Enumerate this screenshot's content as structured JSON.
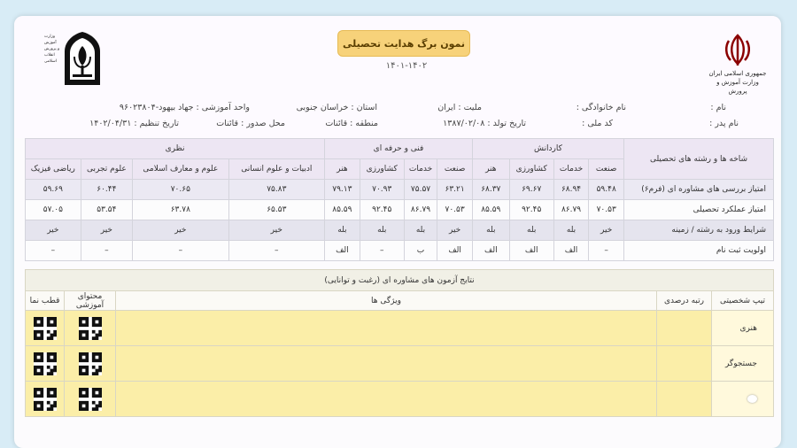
{
  "header": {
    "title": "نمون برگ هدایت تحصیلی",
    "year": "۱۴۰۱-۱۴۰۲",
    "right_logo_lines": [
      "جمهوری اسلامی ایران",
      "وزارت آموزش و پرورش"
    ],
    "left_logo_lines": [
      "وزارت آموزش",
      "و پرورش",
      "انقلاب",
      "اسلامی"
    ]
  },
  "info": {
    "name": "نام :",
    "family": "نام خانوادگی :",
    "nationality": "ملیت : ایران",
    "province": "استان : خراسان جنوبی",
    "unit": "واحد آموزشی : جهاد بیهود-۹۶۰۲۳۸۰۴",
    "father": "نام پدر :",
    "national_code": "کد ملی :",
    "birth": "تاریخ تولد : ۱۳۸۷/۰۲/۰۸",
    "region": "منطقه : قائنات",
    "issue_place": "محل صدور : قائنات",
    "set_date": "تاریخ تنظیم : ۱۴۰۲/۰۴/۳۱"
  },
  "table1": {
    "corner": "شاخه ها و رشته های تحصیلی",
    "groups": [
      "کاردانش",
      "فنی و حرفه ای",
      "نظری"
    ],
    "columns": [
      "صنعت",
      "خدمات",
      "کشاورزی",
      "هنر",
      "صنعت",
      "خدمات",
      "کشاورزی",
      "هنر",
      "ادبیات و علوم انسانی",
      "علوم و معارف اسلامی",
      "علوم تجربی",
      "ریاضی فیزیک"
    ],
    "rows": [
      {
        "label": "امتیاز بررسی های مشاوره ای (فرم۶)",
        "values": [
          "۵۹.۴۸",
          "۶۸.۹۴",
          "۶۹.۶۷",
          "۶۸.۳۷",
          "۶۳.۲۱",
          "۷۵.۵۷",
          "۷۰.۹۳",
          "۷۹.۱۳",
          "۷۵.۸۳",
          "۷۰.۶۵",
          "۶۰.۴۴",
          "۵۹.۶۹"
        ]
      },
      {
        "label": "امتیاز عملکرد تحصیلی",
        "values": [
          "۷۰.۵۳",
          "۸۶.۷۹",
          "۹۲.۴۵",
          "۸۵.۵۹",
          "۷۰.۵۳",
          "۸۶.۷۹",
          "۹۲.۴۵",
          "۸۵.۵۹",
          "۶۵.۵۳",
          "۶۳.۷۸",
          "۵۳.۵۴",
          "۵۷.۰۵"
        ]
      },
      {
        "label": "شرایط ورود به رشته / زمینه",
        "values": [
          "خیر",
          "بله",
          "بله",
          "بله",
          "خیر",
          "بله",
          "بله",
          "بله",
          "خیر",
          "خیر",
          "خیر",
          "خیر"
        ]
      },
      {
        "label": "اولویت ثبت نام",
        "values": [
          "–",
          "الف",
          "الف",
          "الف",
          "الف",
          "ب",
          "–",
          "الف",
          "–",
          "–",
          "–",
          "–"
        ]
      }
    ]
  },
  "table2": {
    "caption": "نتایج آزمون های مشاوره ای (رغبت و توانایی)",
    "columns": [
      "تیپ شخصیتی",
      "رتبه درصدی",
      "ویژگی ها",
      "محتوای آموزشی",
      "قطب نما"
    ],
    "rows": [
      {
        "type": "هنری"
      },
      {
        "type": "جستجوگر"
      },
      {
        "type": ""
      }
    ]
  },
  "colors": {
    "title_bg": "#f7d27a",
    "row_yellow": "#fbeea8",
    "header_purple": "#ede6f3"
  }
}
